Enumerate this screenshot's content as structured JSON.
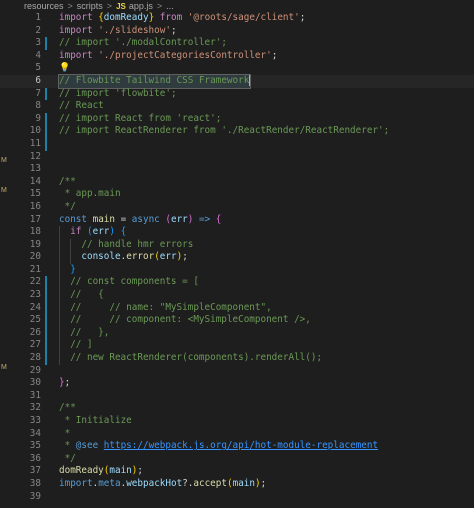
{
  "breadcrumb": {
    "items": [
      "resources",
      "scripts",
      "app.js",
      "..."
    ],
    "file_badge": "JS",
    "separator": ">"
  },
  "gutter_markers": [
    "M",
    "M",
    "M"
  ],
  "editor": {
    "lines": [
      {
        "n": "1",
        "git": "",
        "tokens": [
          [
            "kw2",
            "import "
          ],
          [
            "brace",
            "{"
          ],
          [
            "var",
            "domReady"
          ],
          [
            "brace",
            "}"
          ],
          [
            "kw2",
            " from "
          ],
          [
            "str",
            "'@roots/sage/client'"
          ],
          [
            "punc",
            ";"
          ]
        ]
      },
      {
        "n": "2",
        "git": "",
        "tokens": [
          [
            "kw2",
            "import "
          ],
          [
            "str",
            "'./slideshow'"
          ],
          [
            "punc",
            ";"
          ]
        ]
      },
      {
        "n": "3",
        "git": "mod",
        "tokens": [
          [
            "cmt",
            "// import './modalController';"
          ]
        ]
      },
      {
        "n": "4",
        "git": "",
        "tokens": [
          [
            "kw2",
            "import "
          ],
          [
            "str",
            "'./projectCategoriesController'"
          ],
          [
            "punc",
            ";"
          ]
        ]
      },
      {
        "n": "5",
        "git": "",
        "bulb": true,
        "tokens": []
      },
      {
        "n": "6",
        "git": "",
        "active": true,
        "tokens": [
          [
            "cmt",
            "// Flowbite Tailwind CSS Framework"
          ]
        ]
      },
      {
        "n": "7",
        "git": "mod",
        "tokens": [
          [
            "cmt",
            "// import 'flowbite';"
          ]
        ]
      },
      {
        "n": "8",
        "git": "",
        "tokens": [
          [
            "cmt",
            "// React"
          ]
        ]
      },
      {
        "n": "9",
        "git": "mod",
        "tokens": [
          [
            "cmt",
            "// import React from 'react';"
          ]
        ]
      },
      {
        "n": "10",
        "git": "mod",
        "tokens": [
          [
            "cmt",
            "// import ReactRenderer from './ReactRender/ReactRenderer';"
          ]
        ]
      },
      {
        "n": "11",
        "git": "mod",
        "tokens": []
      },
      {
        "n": "12",
        "git": "",
        "tokens": []
      },
      {
        "n": "13",
        "git": "",
        "tokens": []
      },
      {
        "n": "14",
        "git": "",
        "tokens": [
          [
            "cmt",
            "/**"
          ]
        ]
      },
      {
        "n": "15",
        "git": "",
        "tokens": [
          [
            "cmt",
            " * app.main"
          ]
        ]
      },
      {
        "n": "16",
        "git": "",
        "tokens": [
          [
            "cmt",
            " */"
          ]
        ]
      },
      {
        "n": "17",
        "git": "",
        "tokens": [
          [
            "kw",
            "const "
          ],
          [
            "fn",
            "main"
          ],
          [
            "punc",
            " = "
          ],
          [
            "kw",
            "async "
          ],
          [
            "brace2",
            "("
          ],
          [
            "var",
            "err"
          ],
          [
            "brace2",
            ")"
          ],
          [
            "kw",
            " => "
          ],
          [
            "brace2",
            "{"
          ]
        ]
      },
      {
        "n": "18",
        "git": "",
        "indent": 1,
        "tokens": [
          [
            "kw2",
            "if "
          ],
          [
            "brace3",
            "("
          ],
          [
            "var",
            "err"
          ],
          [
            "brace3",
            ")"
          ],
          [
            "punc",
            " "
          ],
          [
            "brace3",
            "{"
          ]
        ]
      },
      {
        "n": "19",
        "git": "",
        "indent": 2,
        "tokens": [
          [
            "cmt",
            "// handle hmr errors"
          ]
        ]
      },
      {
        "n": "20",
        "git": "",
        "indent": 2,
        "tokens": [
          [
            "var",
            "console"
          ],
          [
            "punc",
            "."
          ],
          [
            "fn",
            "error"
          ],
          [
            "brace",
            "("
          ],
          [
            "var",
            "err"
          ],
          [
            "brace",
            ")"
          ],
          [
            "punc",
            ";"
          ]
        ]
      },
      {
        "n": "21",
        "git": "",
        "indent": 1,
        "tokens": [
          [
            "brace3",
            "}"
          ]
        ]
      },
      {
        "n": "22",
        "git": "mod",
        "indent": 1,
        "tokens": [
          [
            "cmt",
            "// const components = ["
          ]
        ]
      },
      {
        "n": "23",
        "git": "mod",
        "indent": 1,
        "tokens": [
          [
            "cmt",
            "//   {"
          ]
        ]
      },
      {
        "n": "24",
        "git": "mod",
        "indent": 1,
        "tokens": [
          [
            "cmt",
            "//     // name: \"MySimpleComponent\","
          ]
        ]
      },
      {
        "n": "25",
        "git": "mod",
        "indent": 1,
        "tokens": [
          [
            "cmt",
            "//     // component: <MySimpleComponent />,"
          ]
        ]
      },
      {
        "n": "26",
        "git": "mod",
        "indent": 1,
        "tokens": [
          [
            "cmt",
            "//   },"
          ]
        ]
      },
      {
        "n": "27",
        "git": "mod",
        "indent": 1,
        "tokens": [
          [
            "cmt",
            "// ]"
          ]
        ]
      },
      {
        "n": "28",
        "git": "mod",
        "indent": 1,
        "tokens": [
          [
            "cmt",
            "// new ReactRenderer(components).renderAll();"
          ]
        ]
      },
      {
        "n": "29",
        "git": "",
        "tokens": []
      },
      {
        "n": "30",
        "git": "",
        "tokens": [
          [
            "brace2",
            "}"
          ],
          [
            "punc",
            ";"
          ]
        ]
      },
      {
        "n": "31",
        "git": "",
        "tokens": []
      },
      {
        "n": "32",
        "git": "",
        "tokens": [
          [
            "cmt",
            "/**"
          ]
        ]
      },
      {
        "n": "33",
        "git": "",
        "tokens": [
          [
            "cmt",
            " * Initialize"
          ]
        ]
      },
      {
        "n": "34",
        "git": "",
        "tokens": [
          [
            "cmt",
            " *"
          ]
        ]
      },
      {
        "n": "35",
        "git": "",
        "tokens": [
          [
            "cmt",
            " * "
          ],
          [
            "tag",
            "@see"
          ],
          [
            "cmt",
            " "
          ],
          [
            "link",
            "https://webpack.js.org/api/hot-module-replacement"
          ]
        ]
      },
      {
        "n": "36",
        "git": "",
        "tokens": [
          [
            "cmt",
            " */"
          ]
        ]
      },
      {
        "n": "37",
        "git": "",
        "tokens": [
          [
            "fn",
            "domReady"
          ],
          [
            "brace",
            "("
          ],
          [
            "var",
            "main"
          ],
          [
            "brace",
            ")"
          ],
          [
            "punc",
            ";"
          ]
        ]
      },
      {
        "n": "38",
        "git": "",
        "tokens": [
          [
            "kw",
            "import"
          ],
          [
            "punc",
            "."
          ],
          [
            "kw",
            "meta"
          ],
          [
            "punc",
            "."
          ],
          [
            "var",
            "webpackHot"
          ],
          [
            "punc",
            "?."
          ],
          [
            "fn",
            "accept"
          ],
          [
            "brace",
            "("
          ],
          [
            "var",
            "main"
          ],
          [
            "brace",
            ")"
          ],
          [
            "punc",
            ";"
          ]
        ]
      },
      {
        "n": "39",
        "git": "",
        "tokens": []
      }
    ]
  }
}
